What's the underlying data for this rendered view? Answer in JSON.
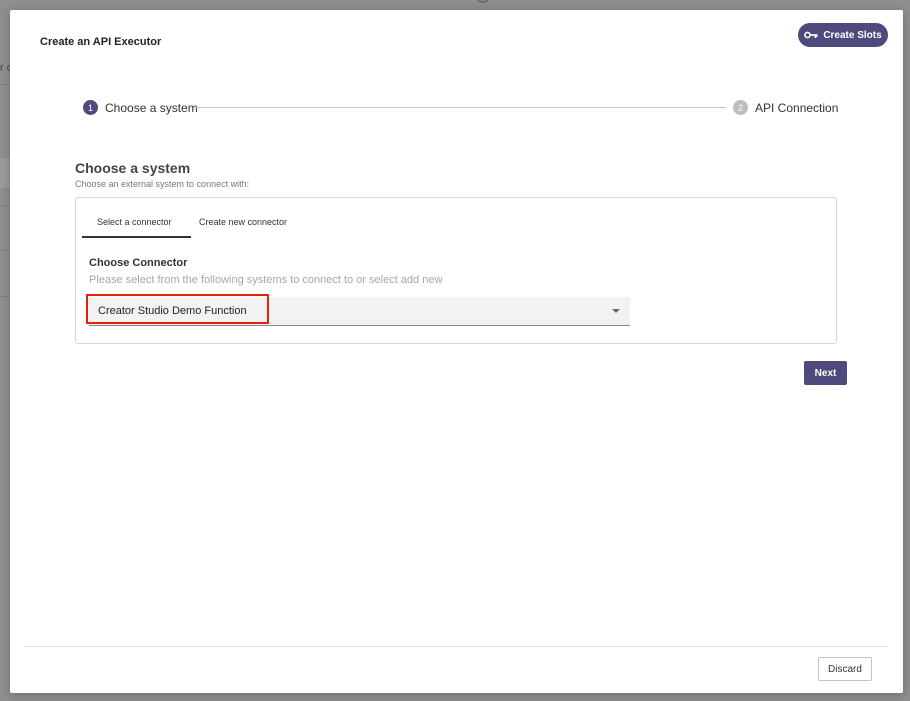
{
  "modal": {
    "title": "Create an API Executor",
    "create_slots_label": "Create Slots"
  },
  "stepper": {
    "steps": [
      {
        "number": "1",
        "label": "Choose a system",
        "state": "active"
      },
      {
        "number": "2",
        "label": "API Connection",
        "state": "inactive"
      }
    ]
  },
  "section": {
    "title": "Choose a system",
    "subtitle": "Choose an external system to connect with:"
  },
  "tabs": [
    {
      "label": "Select a connector",
      "active": true
    },
    {
      "label": "Create new connector",
      "active": false
    }
  ],
  "connector": {
    "label": "Choose Connector",
    "help": "Please select from the following systems to connect to or select add new",
    "selected": "Creator Studio Demo Function"
  },
  "buttons": {
    "next_label": "Next",
    "discard_label": "Discard"
  },
  "background": {
    "sidebar_glyph": "r c"
  },
  "colors": {
    "accent": "#4e4a7d",
    "highlight": "#e8210d",
    "inactive_step": "#bdbdbd"
  }
}
